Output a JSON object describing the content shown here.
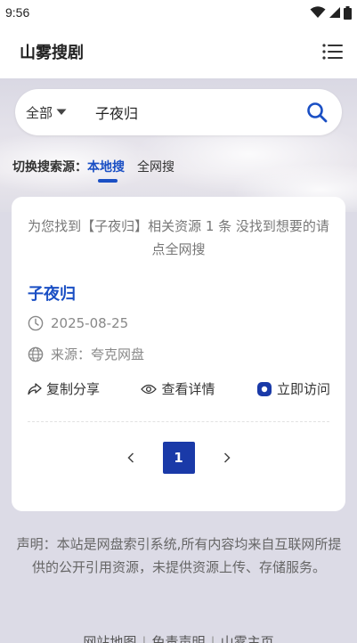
{
  "status_bar": {
    "time": "9:56",
    "icons": [
      "wifi-icon",
      "signal-icon",
      "battery-icon"
    ]
  },
  "header": {
    "title": "山雾搜剧",
    "menu_icon": "menu-icon"
  },
  "search": {
    "scope_label": "全部",
    "query": "子夜归",
    "button_icon": "search-icon"
  },
  "source_switch": {
    "label": "切换搜索源：",
    "tabs": [
      {
        "label": "本地搜",
        "active": true
      },
      {
        "label": "全网搜",
        "active": false
      }
    ]
  },
  "results": {
    "summary": "为您找到【子夜归】相关资源 1 条 没找到想要的请点全网搜",
    "items": [
      {
        "title": "子夜归",
        "date": "2025-08-25",
        "source": "来源：夸克网盘",
        "actions": {
          "copy": "复制分享",
          "details": "查看详情",
          "visit": "立即访问"
        }
      }
    ]
  },
  "pagination": {
    "current": "1",
    "prev_icon": "chevron-left-icon",
    "next_icon": "chevron-right-icon"
  },
  "disclaimer": "声明：本站是网盘索引系统,所有内容均来自互联网所提供的公开引用资源，未提供资源上传、存储服务。",
  "footer": {
    "links": [
      "网站地图",
      "免责声明",
      "山雾主页"
    ],
    "separator": "|"
  },
  "colors": {
    "accent": "#1a4fc4",
    "page_bg": "#dcdbe6",
    "pager_active": "#1a3aa8"
  }
}
